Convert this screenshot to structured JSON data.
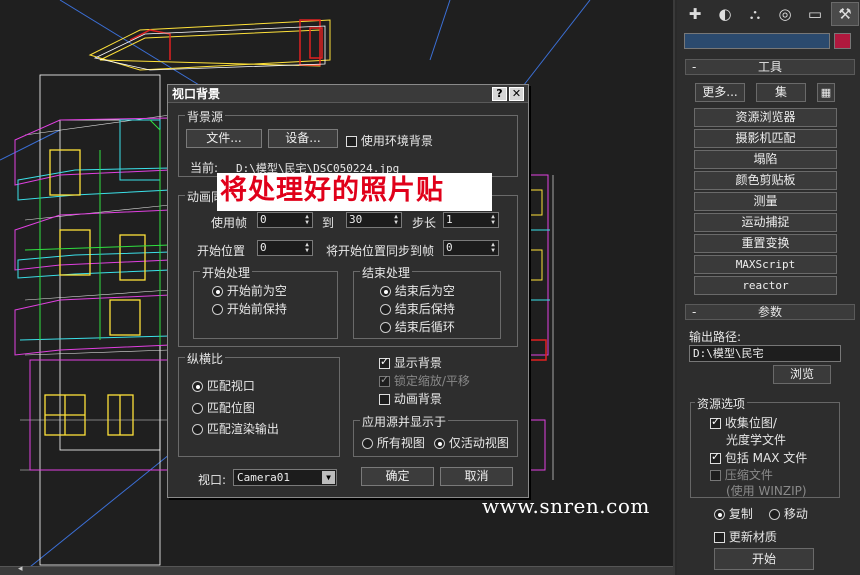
{
  "viewport": {
    "watermark": "www.snren.com"
  },
  "overlay": {
    "text": "将处理好的照片贴"
  },
  "dialog": {
    "title": "视口背景",
    "help_btn": "?",
    "close_btn": "✕",
    "source_group": {
      "legend": "背景源",
      "file_btn": "文件...",
      "device_btn": "设备...",
      "use_env_label": "使用环境背景",
      "use_env_checked": false,
      "current_label": "当前:",
      "current_path": "D:\\模型\\民宅\\DSC050224.jpg"
    },
    "animation_group": {
      "legend": "动画同步",
      "use_frame_label": "使用帧",
      "use_frame_value": "0",
      "to_label": "到",
      "to_value": "30",
      "step_label": "步长",
      "step_value": "1",
      "start_label": "开始位置",
      "start_value": "0",
      "sync_label": "将开始位置同步到帧",
      "sync_value": "0",
      "start_proc": {
        "legend": "开始处理",
        "options": [
          "开始前为空",
          "开始前保持"
        ],
        "selected": 0
      },
      "end_proc": {
        "legend": "结束处理",
        "options": [
          "结束后为空",
          "结束后保持",
          "结束后循环"
        ],
        "selected": 0
      }
    },
    "aspect_group": {
      "legend": "纵横比",
      "options": [
        "匹配视口",
        "匹配位图",
        "匹配渲染输出"
      ],
      "selected": 0
    },
    "display_bg_label": "显示背景",
    "display_bg_checked": true,
    "lock_zoom_label": "锁定缩放/平移",
    "lock_zoom_checked": true,
    "anim_bg_label": "动画背景",
    "anim_bg_checked": false,
    "apply_group": {
      "legend": "应用源并显示于",
      "options": [
        "所有视图",
        "仅活动视图"
      ],
      "selected": 1
    },
    "viewport_label": "视口:",
    "viewport_value": "Camera01",
    "ok_btn": "确定",
    "cancel_btn": "取消"
  },
  "command_panel": {
    "tabs": [
      "create-icon",
      "modify-icon",
      "hierarchy-icon",
      "motion-icon",
      "display-icon",
      "utilities-icon"
    ],
    "active_tab": 5,
    "tools_rollout": {
      "title": "工具",
      "more_btn": "更多...",
      "sets_btn": "集",
      "items": [
        "资源浏览器",
        "摄影机匹配",
        "塌陷",
        "颜色剪贴板",
        "测量",
        "运动捕捉",
        "重置变换",
        "MAXScript",
        "reactor"
      ]
    },
    "params_rollout": {
      "title": "参数",
      "output_path_label": "输出路径:",
      "output_path_value": "D:\\模型\\民宅",
      "browse_btn": "浏览",
      "resource_group": {
        "legend": "资源选项",
        "collect_bitmaps_label": "收集位图/",
        "collect_bitmaps_label2": "光度学文件",
        "collect_bitmaps_checked": true,
        "include_max_label": "包括 MAX 文件",
        "include_max_checked": true,
        "compress_label": "压缩文件",
        "compress_label2": "(使用 WINZIP)",
        "compress_checked": false
      },
      "copy_label": "复制",
      "move_label": "移动",
      "copy_selected": true,
      "update_materials_label": "更新材质",
      "update_materials_checked": false,
      "start_btn": "开始"
    },
    "colors": {
      "name_field": "#2b4a6e",
      "swatch": "#b0193e"
    }
  }
}
